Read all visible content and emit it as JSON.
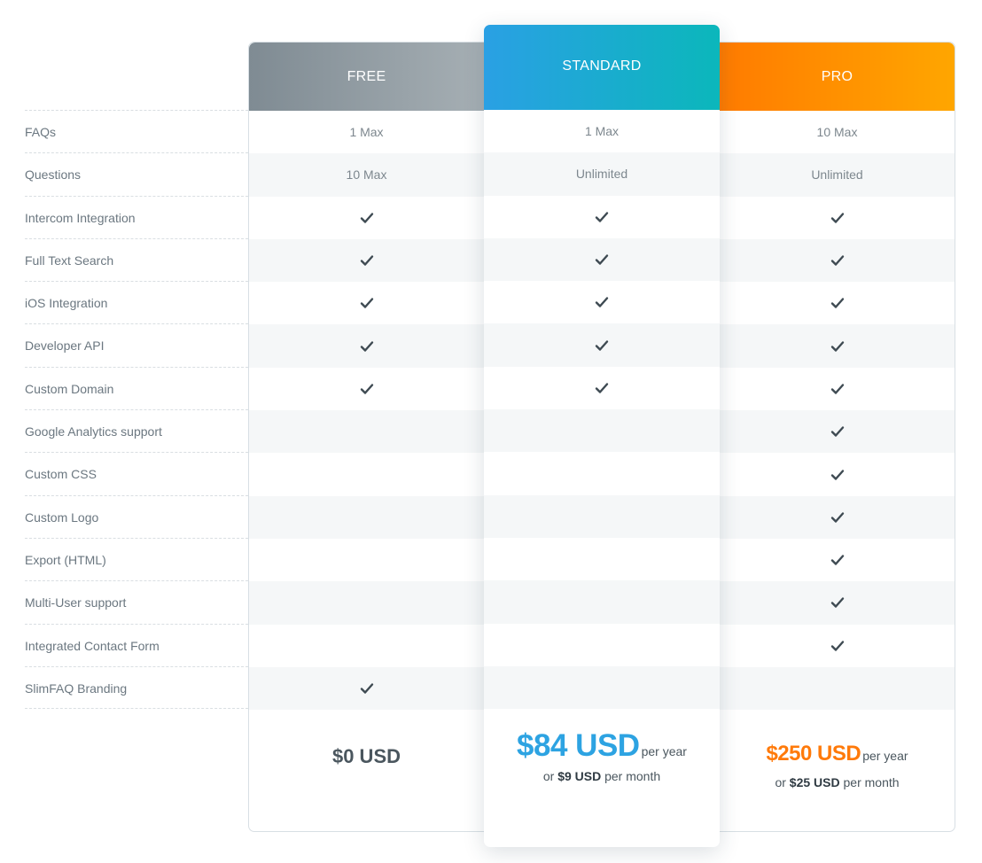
{
  "features": [
    "FAQs",
    "Questions",
    "Intercom Integration",
    "Full Text Search",
    "iOS Integration",
    "Developer API",
    "Custom Domain",
    "Google Analytics support",
    "Custom CSS",
    "Custom Logo",
    "Export (HTML)",
    "Multi-User support",
    "Integrated Contact Form",
    "SlimFAQ Branding"
  ],
  "plans": [
    {
      "name": "FREE",
      "cells": [
        "1 Max",
        "10 Max",
        "check",
        "check",
        "check",
        "check",
        "check",
        "",
        "",
        "",
        "",
        "",
        "",
        "check"
      ],
      "price": {
        "amount": "$0 USD",
        "period": "",
        "or": "",
        "monthly": "",
        "per_month": ""
      }
    },
    {
      "name": "STANDARD",
      "cells": [
        "1 Max",
        "Unlimited",
        "check",
        "check",
        "check",
        "check",
        "check",
        "",
        "",
        "",
        "",
        "",
        "",
        ""
      ],
      "price": {
        "amount": "$84 USD",
        "period": "per year",
        "or": "or",
        "monthly": "$9 USD",
        "per_month": "per month"
      }
    },
    {
      "name": "PRO",
      "cells": [
        "10 Max",
        "Unlimited",
        "check",
        "check",
        "check",
        "check",
        "check",
        "check",
        "check",
        "check",
        "check",
        "check",
        "check",
        ""
      ],
      "price": {
        "amount": "$250 USD",
        "period": "per year",
        "or": "or",
        "monthly": "$25 USD",
        "per_month": "per month"
      }
    }
  ],
  "icons": {
    "check": "check-icon"
  },
  "colors": {
    "free_header": [
      "#7f8b93",
      "#a6afb4"
    ],
    "standard_header": [
      "#2aa0e4",
      "#0bb7bb"
    ],
    "pro_header": [
      "#ff7b00",
      "#ffa600"
    ],
    "standard_price": "#2da3e2",
    "pro_price": "#ff7a0a",
    "check": "#3e4a52"
  }
}
